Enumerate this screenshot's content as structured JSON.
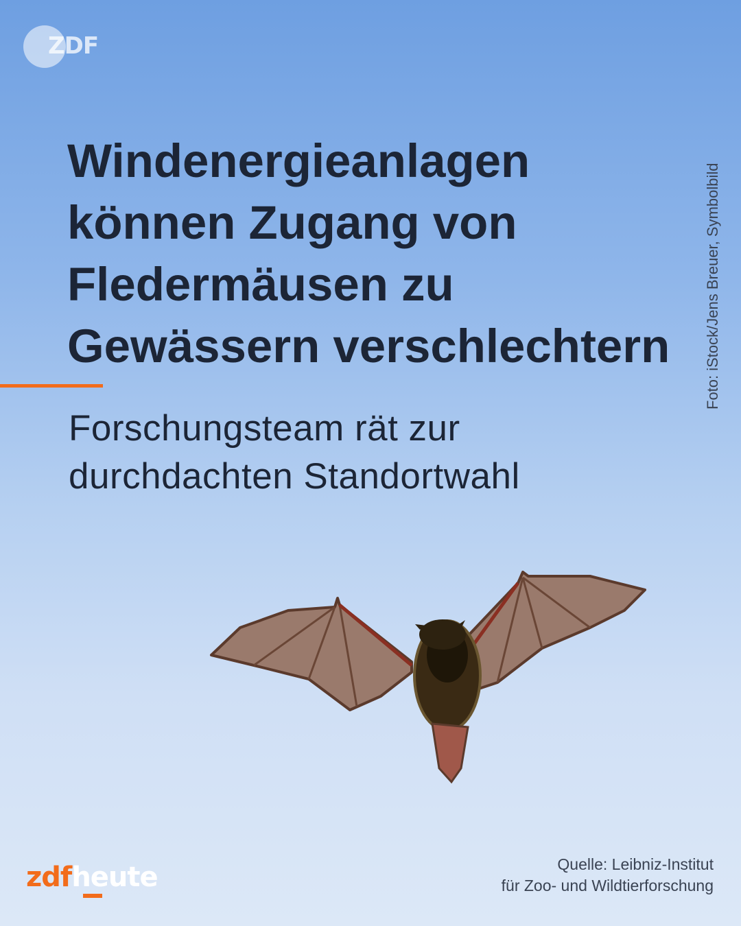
{
  "logo": {
    "text": "ZDF"
  },
  "headline": {
    "lines": [
      "Windenergieanlagen",
      "können Zugang von",
      "Fledermäusen zu",
      "Gewässern verschlechtern"
    ]
  },
  "subline": {
    "lines": [
      "Forschungsteam rät zur",
      "durchdachten Standortwahl"
    ]
  },
  "photo_credit": "Foto: iStock/Jens Breuer, Symbolbild",
  "brand": {
    "part1": "zdf",
    "part2": "heute"
  },
  "source": {
    "line1": "Quelle: Leibniz-Institut",
    "line2": "für Zoo- und Wildtierforschung"
  },
  "colors": {
    "accent": "#f26c1b",
    "text": "#1c2536",
    "sky_top": "#6e9fe1",
    "sky_bottom": "#dce8f7"
  },
  "icons": {
    "bat": "bat-illustration",
    "logo": "zdf-logo-icon"
  }
}
